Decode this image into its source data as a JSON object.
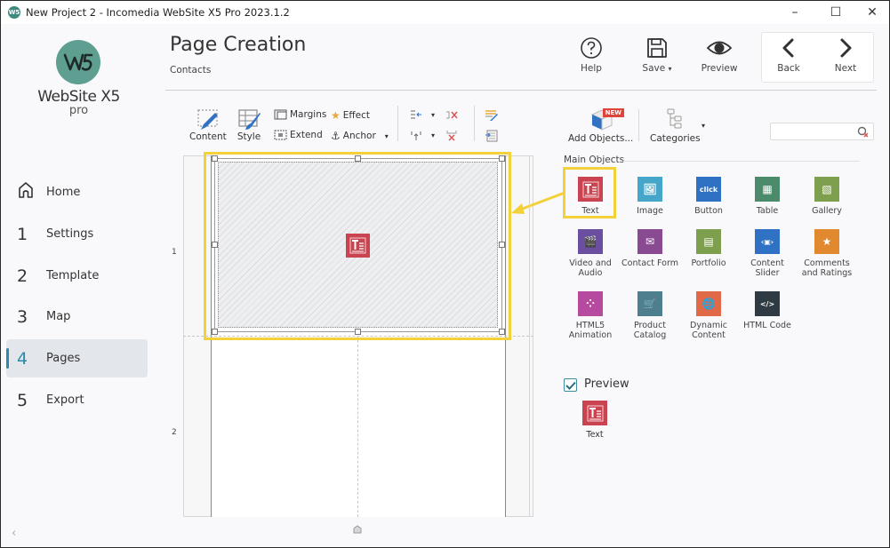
{
  "window": {
    "title": "New Project 2 - Incomedia WebSite X5 Pro 2023.1.2",
    "app_icon_text": "W5",
    "controls": {
      "minimize": "–",
      "maximize": "☐",
      "close": "✕"
    }
  },
  "logo": {
    "mark": "W5",
    "name": "WebSite X5",
    "edition": "pro",
    "brand_color": "#5e9f92"
  },
  "sidebar": {
    "items": [
      {
        "num": "",
        "label": "Home",
        "icon": "home-icon",
        "active": false
      },
      {
        "num": "1",
        "label": "Settings",
        "active": false
      },
      {
        "num": "2",
        "label": "Template",
        "active": false
      },
      {
        "num": "3",
        "label": "Map",
        "active": false
      },
      {
        "num": "4",
        "label": "Pages",
        "active": true
      },
      {
        "num": "5",
        "label": "Export",
        "active": false
      }
    ],
    "collapse_icon": "‹",
    "accent_color": "#2a8aa9"
  },
  "header": {
    "title": "Page Creation",
    "subtitle": "Contacts",
    "buttons": {
      "help": "Help",
      "save": "Save",
      "preview": "Preview",
      "back": "Back",
      "next": "Next"
    },
    "save_dropdown": "▾"
  },
  "toolbar": {
    "content": "Content",
    "style": "Style",
    "margins": "Margins",
    "extend": "Extend",
    "effect": "Effect",
    "anchor": "Anchor",
    "dropdown": "▾",
    "add_objects": "Add Objects...",
    "new_badge": "NEW",
    "categories": "Categories"
  },
  "search": {
    "placeholder": "",
    "value": ""
  },
  "canvas": {
    "rows": [
      "1",
      "2"
    ],
    "selected_object": "Text",
    "highlight_color": "#f2d13a"
  },
  "objects_panel": {
    "section_label": "Main Objects",
    "items": [
      {
        "label": "Text",
        "color": "#c94450",
        "glyph": "T≡",
        "highlighted": true
      },
      {
        "label": "Image",
        "color": "#45a6c9",
        "glyph": "🖼"
      },
      {
        "label": "Button",
        "color": "#2f72c4",
        "glyph": "click"
      },
      {
        "label": "Table",
        "color": "#4b8a6a",
        "glyph": "▦"
      },
      {
        "label": "Gallery",
        "color": "#7ea04e",
        "glyph": "▧"
      },
      {
        "label": "Video and Audio",
        "color": "#6a4fa0",
        "glyph": "🎬"
      },
      {
        "label": "Contact Form",
        "color": "#8a4a92",
        "glyph": "✉"
      },
      {
        "label": "Portfolio",
        "color": "#7ea04e",
        "glyph": "▤"
      },
      {
        "label": "Content Slider",
        "color": "#2f72c4",
        "glyph": "‹▣›"
      },
      {
        "label": "Comments and Ratings",
        "color": "#e0892e",
        "glyph": "★"
      },
      {
        "label": "HTML5 Animation",
        "color": "#b64a9e",
        "glyph": "⁘"
      },
      {
        "label": "Product Catalog",
        "color": "#4d7f8f",
        "glyph": "🛒"
      },
      {
        "label": "Dynamic Content",
        "color": "#e06a48",
        "glyph": "🌐"
      },
      {
        "label": "HTML Code",
        "color": "#2e3b42",
        "glyph": "</>"
      }
    ]
  },
  "preview": {
    "label": "Preview",
    "checked": true,
    "item_label": "Text",
    "item_color": "#c94450"
  }
}
